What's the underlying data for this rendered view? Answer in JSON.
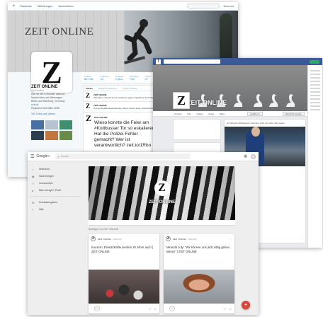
{
  "twitter": {
    "nav": [
      "Startseite",
      "Mitteilungen",
      "Nachrichten"
    ],
    "account": "Account",
    "header_brand": "ZEIT ONLINE",
    "logo_letter": "Z",
    "stats": [
      {
        "label": "Tweets",
        "value": "80 Tsd."
      },
      {
        "label": "Folge ich",
        "value": "21"
      },
      {
        "label": "Follower",
        "value": "1 Mio."
      },
      {
        "label": "Favoriten",
        "value": "730"
      },
      {
        "label": "Listen",
        "value": "47"
      }
    ],
    "follow_label": "Folgen",
    "profile_name": "ZEIT ONLINE",
    "profile_handle": "@zeitonline",
    "profile_bio": "Hier ist ZEIT ONLINE. Alles zu Nachrichten und Meinungen.",
    "location": "Berlin und Hamburg, Germany",
    "website": "zeit.de",
    "joined": "Registriert seit März 2008",
    "photos_label": "183 Fotos und Videos",
    "tabs": [
      "Tweets",
      "Tweets & Antworten",
      "Fotos & Videos"
    ],
    "tweets": [
      {
        "author": "ZEIT ONLINE",
        "text": "Schreiben: Gericht trennt Verfahren gegen angebliche Zuschläge."
      },
      {
        "author": "ZEIT ONLINE",
        "text": "Tod der Gebrauchsanweisung: Wann Nutzer lesen statt wischen."
      },
      {
        "author": "ZEIT ONLINE",
        "text": "Wieso konnte die Feier am #Kottbusser Tor so eskalieren? Hat die Polizei Fehler gemacht? Wer ist verantwortlich? zeit.to/1Rbn"
      }
    ]
  },
  "facebook": {
    "page_name": "ZEIT ONLINE",
    "logo_letter": "Z",
    "tabs": [
      "Chronik",
      "Info",
      "Videos",
      "Fotos",
      "Mehr"
    ],
    "like_label": "Gefällt mir",
    "message_label": "Nachricht senden",
    "post_text": "Der Ehrgeiz-Wettbewerb zwischen CSU und CDU geht weiter.",
    "post_title": "Flüchtlinge",
    "post_source": "ZEIT.DE"
  },
  "gplus": {
    "app_name": "Google+",
    "search_placeholder": "Suchen",
    "nav": [
      {
        "icon": "home-icon",
        "label": "Übersicht"
      },
      {
        "icon": "people-icon",
        "label": "Sammlungen"
      },
      {
        "icon": "community-icon",
        "label": "Communitys"
      },
      {
        "icon": "profile-icon",
        "label": "Mein Google+ Profil"
      },
      {
        "icon": "feedback-icon",
        "label": "Feedback geben"
      },
      {
        "icon": "help-icon",
        "label": "Hilfe"
      }
    ],
    "cover_name": "ZEIT ONLINE",
    "logo_letter": "Z",
    "count_label": "Beiträge von ZEIT ONLINE",
    "cards": [
      {
        "author": "ZEIT ONLINE",
        "meta": "Öffentlich",
        "text": "Konzern: Einsatzkräfte werden 20 Jahre auch | ZEIT ONLINE"
      },
      {
        "author": "ZEIT ONLINE",
        "meta": "Öffentlich",
        "text": "Miranda July: \"Wir können uns jetzt völlig gehen lassen\" | ZEIT ONLINE"
      }
    ],
    "fab": "+"
  },
  "colors": {
    "twitter_blue": "#55acee",
    "facebook_blue": "#3b5998",
    "gplus_red": "#db4437"
  }
}
